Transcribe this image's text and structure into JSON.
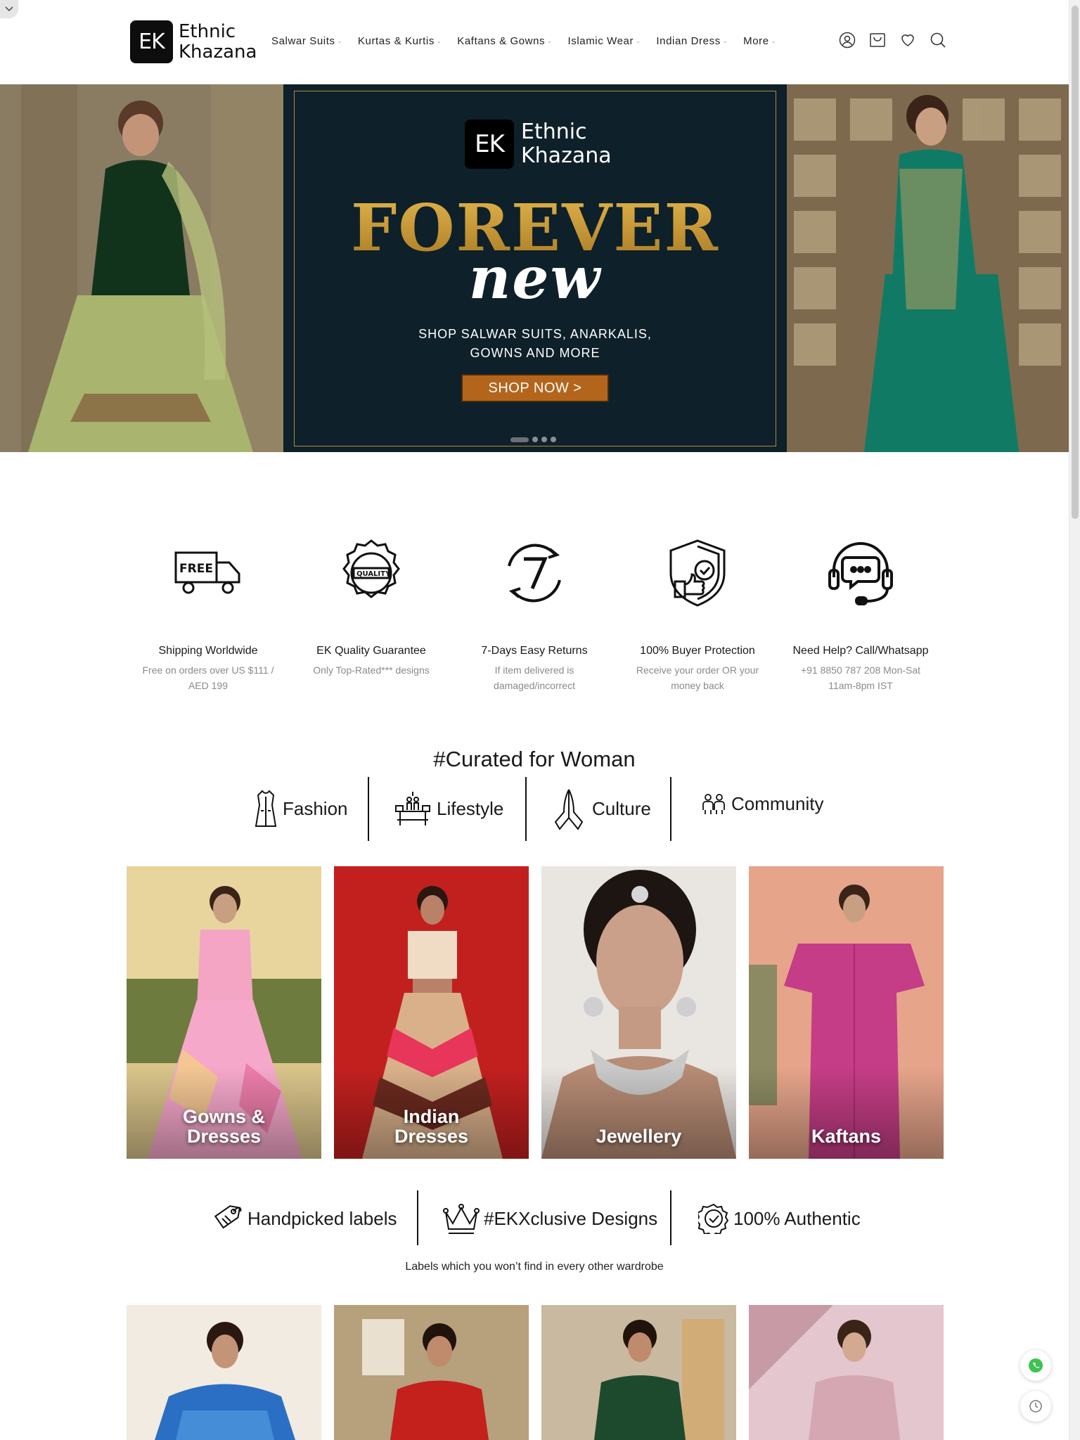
{
  "brand": {
    "logo_mark": "EK",
    "name_line1": "Ethnic",
    "name_line2": "Khazana"
  },
  "nav": {
    "items": [
      {
        "label": "Salwar Suits"
      },
      {
        "label": "Kurtas & Kurtis"
      },
      {
        "label": "Kaftans & Gowns"
      },
      {
        "label": "Islamic Wear"
      },
      {
        "label": "Indian Dress"
      },
      {
        "label": "More"
      }
    ],
    "icons": [
      "user-icon",
      "cart-icon",
      "heart-icon",
      "search-icon"
    ]
  },
  "hero": {
    "headline": "FOREVER",
    "script": "new",
    "subtitle_line1": "SHOP SALWAR SUITS, ANARKALIS,",
    "subtitle_line2": "GOWNS AND MORE",
    "cta": "SHOP NOW  >",
    "slide_count": 4,
    "active_slide": 1
  },
  "features": [
    {
      "icon": "free-truck-icon",
      "title": "Shipping Worldwide",
      "desc": "Free on orders over US $111 / AED 199"
    },
    {
      "icon": "quality-badge-icon",
      "title": "EK Quality Guarantee",
      "desc": "Only Top-Rated*** designs"
    },
    {
      "icon": "seven-days-return-icon",
      "title": "7-Days Easy Returns",
      "desc": "If item delivered is damaged/incorrect"
    },
    {
      "icon": "shield-check-icon",
      "title": "100% Buyer Protection",
      "desc": "Receive your order OR your money back"
    },
    {
      "icon": "headset-chat-icon",
      "title": "Need Help? Call/Whatsapp",
      "desc": "+91 8850 787 208 Mon-Sat 11am-8pm IST"
    }
  ],
  "curated": {
    "title": "#Curated for Woman",
    "categories": [
      {
        "icon": "dress-icon",
        "label": "Fashion"
      },
      {
        "icon": "dining-table-icon",
        "label": "Lifestyle"
      },
      {
        "icon": "praying-hands-icon",
        "label": "Culture"
      },
      {
        "icon": "people-icon",
        "label": "Community"
      }
    ],
    "cards": [
      {
        "label_line1": "Gowns &",
        "label_line2": "Dresses"
      },
      {
        "label_line1": "Indian",
        "label_line2": "Dresses"
      },
      {
        "label_line1": "Jewellery",
        "label_line2": ""
      },
      {
        "label_line1": "Kaftans",
        "label_line2": ""
      }
    ]
  },
  "labels": {
    "items": [
      {
        "icon": "price-tag-icon",
        "label": "Handpicked labels"
      },
      {
        "icon": "crown-icon",
        "label": "#EKXclusive Designs"
      },
      {
        "icon": "verified-badge-icon",
        "label": "100% Authentic"
      }
    ],
    "subtitle": "Labels which you won’t find in every other wardrobe"
  },
  "colors": {
    "hero_bg": "#0e2029",
    "gold": "#c89a3a",
    "cta": "#b4651c",
    "text": "#1a1a1a",
    "muted": "#8a8a8a"
  }
}
